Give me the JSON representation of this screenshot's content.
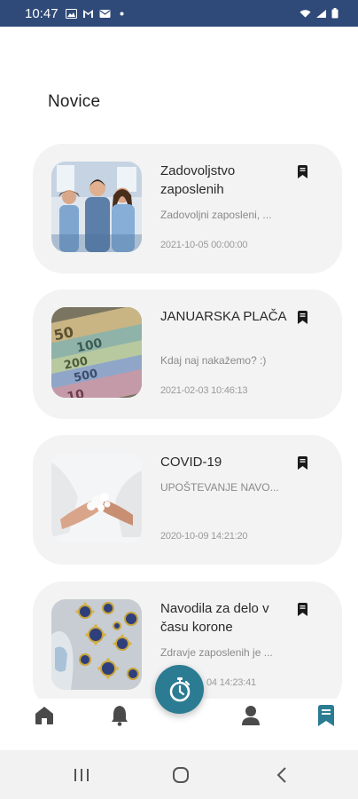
{
  "status_bar": {
    "time": "10:47",
    "left_icons": [
      "image-icon",
      "gmail-icon",
      "mail-icon",
      "dot-icon"
    ],
    "right_icons": [
      "wifi-icon",
      "signal-icon",
      "battery-icon"
    ]
  },
  "page": {
    "title": "Novice"
  },
  "news": [
    {
      "title": "Zadovoljstvo zaposlenih",
      "excerpt": "Zadovoljni zaposleni, ...",
      "date": "2021-10-05 00:00:00",
      "image": "office-team-photo"
    },
    {
      "title": "JANUARSKA PLAČA",
      "excerpt": "Kdaj naj nakažemo? :)",
      "date": "2021-02-03 10:46:13",
      "image": "banknotes-photo"
    },
    {
      "title": "COVID-19",
      "excerpt": "UPOŠTEVANJE NAVO...",
      "date": "2020-10-09 14:21:20",
      "image": "hand-washing-photo"
    },
    {
      "title": "Navodila za delo v času korone",
      "excerpt": "Zdravje zaposlenih je ...",
      "date": "04 14:23:41",
      "image": "virus-photo"
    }
  ],
  "bottom_nav": {
    "items": [
      "home-icon",
      "bell-icon",
      "stopwatch-icon",
      "profile-icon",
      "bookmark-icon"
    ],
    "active": "bookmark-icon",
    "fab_color": "#2b7c93"
  },
  "colors": {
    "status_bar": "#2f4a78",
    "card_bg": "#f3f3f3",
    "accent": "#2b7c93"
  }
}
